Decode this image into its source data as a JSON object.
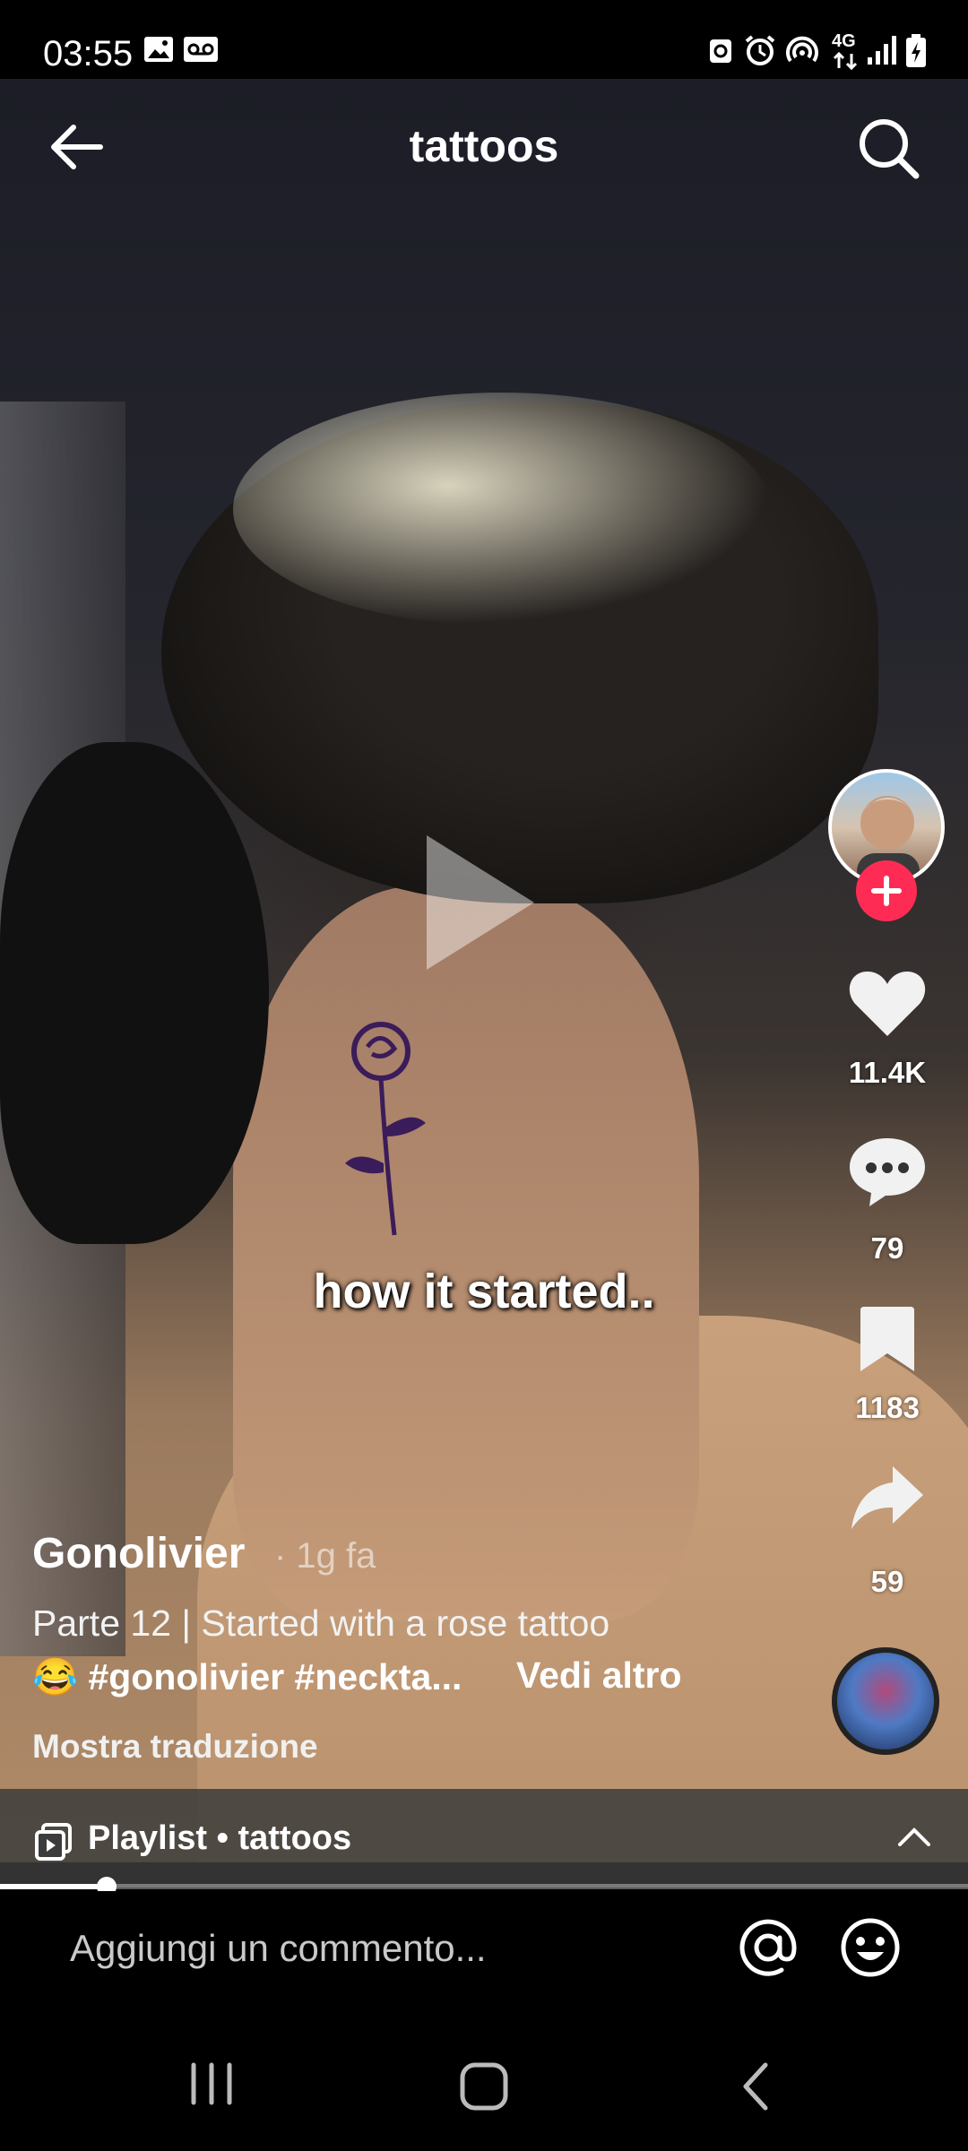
{
  "status_bar": {
    "time": "03:55",
    "left_icons": [
      "gallery-icon",
      "voicemail-icon"
    ],
    "right_icons": [
      "android-icon",
      "alarm-icon",
      "hotspot-icon",
      "4g-icon",
      "signal-icon",
      "battery-charging-icon"
    ],
    "network": "4G"
  },
  "top_bar": {
    "title": "tattoos",
    "back_icon": "arrow-left-icon",
    "search_icon": "search-icon"
  },
  "video": {
    "caption": "how it started..",
    "state": "paused",
    "progress": 0.11
  },
  "rail": {
    "likes": "11.4K",
    "comments": "79",
    "saves": "1183",
    "shares": "59",
    "follow_icon": "plus-icon"
  },
  "post": {
    "author": "Gonolivier",
    "time": "· 1g fa",
    "desc_line1": "Parte 12 | Started with a rose tattoo",
    "desc_line2": "😂 #gonolivier #neckta...",
    "see_more": "Vedi altro",
    "translate": "Mostra traduzione"
  },
  "playlist": {
    "label": "Playlist • tattoos"
  },
  "comment": {
    "placeholder": "Aggiungi un commento..."
  },
  "colors": {
    "accent": "#fe2c55",
    "background": "#000000"
  }
}
